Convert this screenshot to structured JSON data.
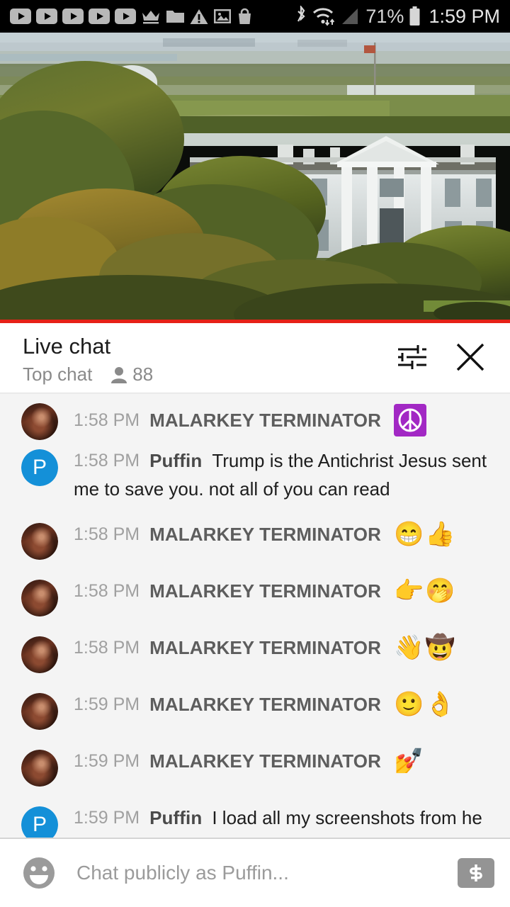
{
  "status_bar": {
    "background": "#000000",
    "left_icons": [
      {
        "name": "youtube-notification-icon-1",
        "glyph": "youtube"
      },
      {
        "name": "youtube-notification-icon-2",
        "glyph": "youtube"
      },
      {
        "name": "youtube-notification-icon-3",
        "glyph": "youtube"
      },
      {
        "name": "youtube-notification-icon-4",
        "glyph": "youtube"
      },
      {
        "name": "youtube-notification-icon-5",
        "glyph": "youtube"
      },
      {
        "name": "crown-icon",
        "glyph": "crown"
      },
      {
        "name": "folder-icon",
        "glyph": "folder"
      },
      {
        "name": "warning-icon",
        "glyph": "warning"
      },
      {
        "name": "image-icon",
        "glyph": "image"
      },
      {
        "name": "shopping-bag-icon",
        "glyph": "bag"
      }
    ],
    "right_icons": [
      {
        "name": "bluetooth-icon",
        "glyph": "bluetooth"
      },
      {
        "name": "wifi-icon",
        "glyph": "wifi"
      },
      {
        "name": "cell-signal-icon",
        "glyph": "signal"
      }
    ],
    "battery_percent": "71%",
    "clock": "1:59 PM"
  },
  "player": {
    "progress_percent": 100,
    "progress_color": "#e62117",
    "scene": "white-house-daytime"
  },
  "chat_header": {
    "title": "Live chat",
    "subtitle": "Top chat",
    "viewer_count": "88",
    "settings_label": "tune-icon",
    "close_label": "close-icon"
  },
  "messages": [
    {
      "avatar_type": "photo",
      "avatar_letter": "",
      "time": "1:58 PM",
      "author": "MALARKEY TERMINATOR",
      "text": "",
      "emoji": "",
      "sticker": "peace-sign-purple"
    },
    {
      "avatar_type": "letter",
      "avatar_letter": "P",
      "time": "1:58 PM",
      "author": "Puffin",
      "text": "Trump is the Antichrist Jesus sent me to save you. not all of you can read",
      "emoji": "",
      "sticker": ""
    },
    {
      "avatar_type": "photo",
      "avatar_letter": "",
      "time": "1:58 PM",
      "author": "MALARKEY TERMINATOR",
      "text": "",
      "emoji": "😁👍",
      "sticker": ""
    },
    {
      "avatar_type": "photo",
      "avatar_letter": "",
      "time": "1:58 PM",
      "author": "MALARKEY TERMINATOR",
      "text": "",
      "emoji": "👉🤭",
      "sticker": ""
    },
    {
      "avatar_type": "photo",
      "avatar_letter": "",
      "time": "1:58 PM",
      "author": "MALARKEY TERMINATOR",
      "text": "",
      "emoji": "👋🤠",
      "sticker": ""
    },
    {
      "avatar_type": "photo",
      "avatar_letter": "",
      "time": "1:59 PM",
      "author": "MALARKEY TERMINATOR",
      "text": "",
      "emoji": "🙂👌",
      "sticker": ""
    },
    {
      "avatar_type": "photo",
      "avatar_letter": "",
      "time": "1:59 PM",
      "author": "MALARKEY TERMINATOR",
      "text": "",
      "emoji": "💅",
      "sticker": ""
    },
    {
      "avatar_type": "letter",
      "avatar_letter": "P",
      "time": "1:59 PM",
      "author": "Puffin",
      "text": "I load all my screenshots from he re so Antifa can track you too btw",
      "emoji": "",
      "sticker": ""
    }
  ],
  "composer": {
    "emoji_button_label": "emoji-icon",
    "placeholder": "Chat publicly as Puffin...",
    "value": "",
    "superchat_label": "$"
  },
  "colors": {
    "accent_red": "#e62117",
    "avatar_blue": "#1490d8",
    "sticker_purple": "#a228c4",
    "chat_bg": "#f4f4f4"
  }
}
